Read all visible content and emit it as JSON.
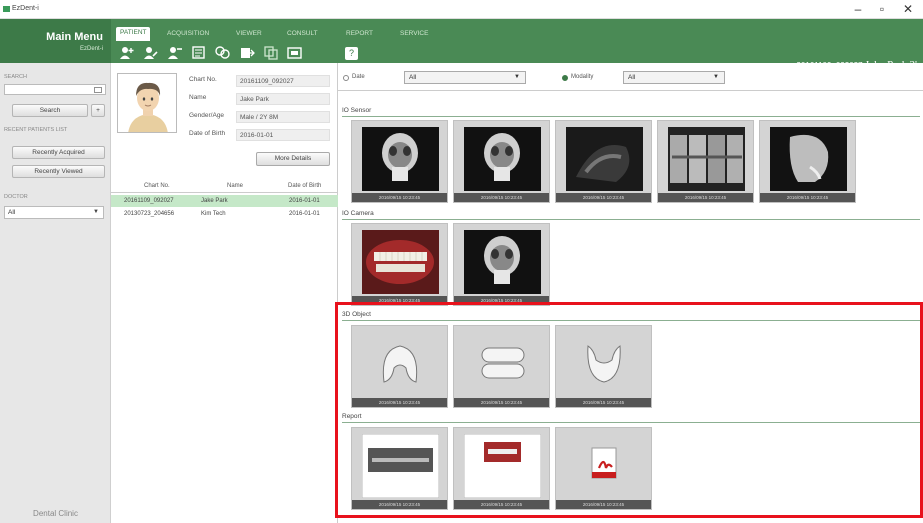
{
  "window": {
    "title": "EzDent-i",
    "minimize": "–",
    "maximize": "▫",
    "close": "✕"
  },
  "main_menu": {
    "title": "Main Menu",
    "subtitle": "EzDent-i"
  },
  "tabs": [
    {
      "label": "PATIENT",
      "active": true
    },
    {
      "label": "ACQUISITION",
      "active": false
    },
    {
      "label": "VIEWER",
      "active": false
    },
    {
      "label": "CONSULT",
      "active": false
    },
    {
      "label": "REPORT",
      "active": false
    },
    {
      "label": "SERVICE",
      "active": false
    }
  ],
  "toolbar_icons": [
    "add-patient-icon",
    "edit-patient-icon",
    "delete-patient-icon",
    "patient-list-icon",
    "merge-patient-icon",
    "export-patient-icon",
    "copy-patient-icon",
    "screen-capture-icon",
    "help-icon"
  ],
  "patient_banner": {
    "chart_no": "20161109_092027",
    "name": "Jake Park",
    "suffix": "2'"
  },
  "sidebar": {
    "search_label": "SEARCH",
    "search_value": "",
    "search_button": "Search",
    "plus_button": "+",
    "recent_label": "RECENT PATIENTS LIST",
    "recently_acquired": "Recently Acquired",
    "recently_viewed": "Recently Viewed",
    "doctor_label": "DOCTOR",
    "doctor_value": "All",
    "clinic": "Dental Clinic"
  },
  "patient_info": {
    "fields": [
      {
        "label": "Chart No.",
        "value": "20161109_092027"
      },
      {
        "label": "Name",
        "value": "Jake Park"
      },
      {
        "label": "Gender/Age",
        "value": "Male / 2Y 8M"
      },
      {
        "label": "Date of Birth",
        "value": "2016-01-01"
      }
    ],
    "more_details": "More Details"
  },
  "patient_list": {
    "headers": [
      "Chart No.",
      "Name",
      "Date of Birth"
    ],
    "rows": [
      {
        "chart": "20161109_092027",
        "name": "Jake Park",
        "dob": "2016-01-01",
        "selected": true
      },
      {
        "chart": "20130723_204656",
        "name": "Kim Tech",
        "dob": "2016-01-01",
        "selected": false
      }
    ]
  },
  "filters": {
    "date_label": "Date",
    "date_value": "All",
    "modality_label": "Modality",
    "modality_value": "All"
  },
  "sections": [
    {
      "title": "IO Sensor",
      "items": [
        {
          "type": "xray-ceph-front",
          "caption": "2016/09/15 10:23:45"
        },
        {
          "type": "xray-ceph-front",
          "caption": "2016/09/15 10:23:45"
        },
        {
          "type": "xray-dark",
          "caption": "2016/09/15 10:23:45"
        },
        {
          "type": "xray-pano-strips",
          "caption": "2016/09/15 10:23:45"
        },
        {
          "type": "xray-ceph-lateral",
          "caption": "2016/09/15 10:23:45"
        }
      ]
    },
    {
      "title": "IO Camera",
      "items": [
        {
          "type": "photo-teeth",
          "caption": "2016/09/15 10:23:45"
        },
        {
          "type": "xray-ceph-front",
          "caption": "2016/09/15 10:23:45"
        }
      ]
    },
    {
      "title": "3D Object",
      "items": [
        {
          "type": "model-upper-arch",
          "caption": "2016/09/15 10:23:45"
        },
        {
          "type": "model-occlusion",
          "caption": "2016/09/15 10:23:45"
        },
        {
          "type": "model-lower-arch",
          "caption": "2016/09/15 10:23:45"
        }
      ]
    },
    {
      "title": "Report",
      "items": [
        {
          "type": "report-xray",
          "caption": "2016/09/15 10:23:45"
        },
        {
          "type": "report-photo",
          "caption": "2016/09/15 10:23:45"
        },
        {
          "type": "report-pdf",
          "caption": "2016/09/15 10:23:45"
        }
      ]
    }
  ],
  "colors": {
    "header": "#4a8a55",
    "accent": "#3d7a48",
    "highlight": "#e8121c",
    "selected_row": "#c5e8c8"
  }
}
